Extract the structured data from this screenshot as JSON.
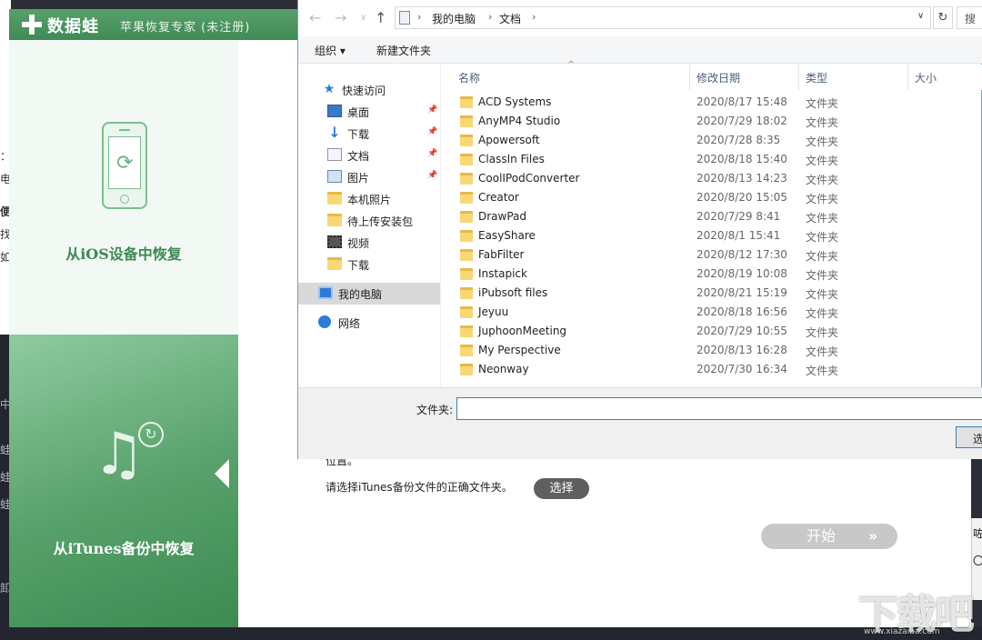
{
  "background": {
    "left_chars": [
      "：",
      "电",
      "便",
      "找",
      "如"
    ],
    "left_dark_chars": [
      "中",
      "蛙",
      "蛙",
      "蛙",
      "卸"
    ],
    "right_chars": [
      "咗",
      "〇"
    ]
  },
  "app": {
    "logo": "数据蛙",
    "subtitle": "苹果恢复专家 (未注册)",
    "ios_label": "从iOS设备中恢复",
    "itunes_label": "从iTunes备份中恢复",
    "hint_tail": "位置。",
    "hint": "请选择iTunes备份文件的正确文件夹。",
    "choose_label": "选择",
    "start_label": "开始",
    "start_arrow": "»",
    "accent": "#3f8a55"
  },
  "dialog": {
    "breadcrumb": [
      "我的电脑",
      "文档"
    ],
    "search_placeholder": "搜",
    "organize": "组织 ▾",
    "new_folder": "新建文件夹",
    "nav": {
      "quick_access": "快速访问",
      "quick_items": [
        {
          "label": "桌面",
          "icon": "desktop-icon",
          "pinned": true
        },
        {
          "label": "下载",
          "icon": "download-icon",
          "pinned": true
        },
        {
          "label": "文档",
          "icon": "document-icon",
          "pinned": true
        },
        {
          "label": "图片",
          "icon": "picture-icon",
          "pinned": true
        },
        {
          "label": "本机照片",
          "icon": "folder-icon",
          "pinned": false
        },
        {
          "label": "待上传安装包",
          "icon": "folder-icon",
          "pinned": false
        },
        {
          "label": "视频",
          "icon": "video-icon",
          "pinned": false
        },
        {
          "label": "下载",
          "icon": "folder-icon",
          "pinned": false
        }
      ],
      "this_pc": "我的电脑",
      "network": "网络"
    },
    "columns": {
      "name": "名称",
      "date": "修改日期",
      "type": "类型",
      "size": "大小"
    },
    "files": [
      {
        "name": "ACD Systems",
        "date": "2020/8/17 15:48",
        "type": "文件夹"
      },
      {
        "name": "AnyMP4 Studio",
        "date": "2020/7/29 18:02",
        "type": "文件夹"
      },
      {
        "name": "Apowersoft",
        "date": "2020/7/28 8:35",
        "type": "文件夹"
      },
      {
        "name": "ClassIn Files",
        "date": "2020/8/18 15:40",
        "type": "文件夹"
      },
      {
        "name": "CoolIPodConverter",
        "date": "2020/8/13 14:23",
        "type": "文件夹"
      },
      {
        "name": "Creator",
        "date": "2020/8/20 15:05",
        "type": "文件夹"
      },
      {
        "name": "DrawPad",
        "date": "2020/7/29 8:41",
        "type": "文件夹"
      },
      {
        "name": "EasyShare",
        "date": "2020/8/1 15:41",
        "type": "文件夹"
      },
      {
        "name": "FabFilter",
        "date": "2020/8/12 17:30",
        "type": "文件夹"
      },
      {
        "name": "Instapick",
        "date": "2020/8/19 10:08",
        "type": "文件夹"
      },
      {
        "name": "iPubsoft files",
        "date": "2020/8/21 15:19",
        "type": "文件夹"
      },
      {
        "name": "Jeyuu",
        "date": "2020/8/18 16:56",
        "type": "文件夹"
      },
      {
        "name": "JuphoonMeeting",
        "date": "2020/7/29 10:55",
        "type": "文件夹"
      },
      {
        "name": "My Perspective",
        "date": "2020/8/13 16:28",
        "type": "文件夹"
      },
      {
        "name": "Neonway",
        "date": "2020/7/30 16:34",
        "type": "文件夹"
      }
    ],
    "folder_label": "文件夹:",
    "folder_value": "",
    "select_label": "选择文件夹"
  },
  "watermark": {
    "text": "下载吧",
    "url": "www.xiazaiba.com"
  }
}
